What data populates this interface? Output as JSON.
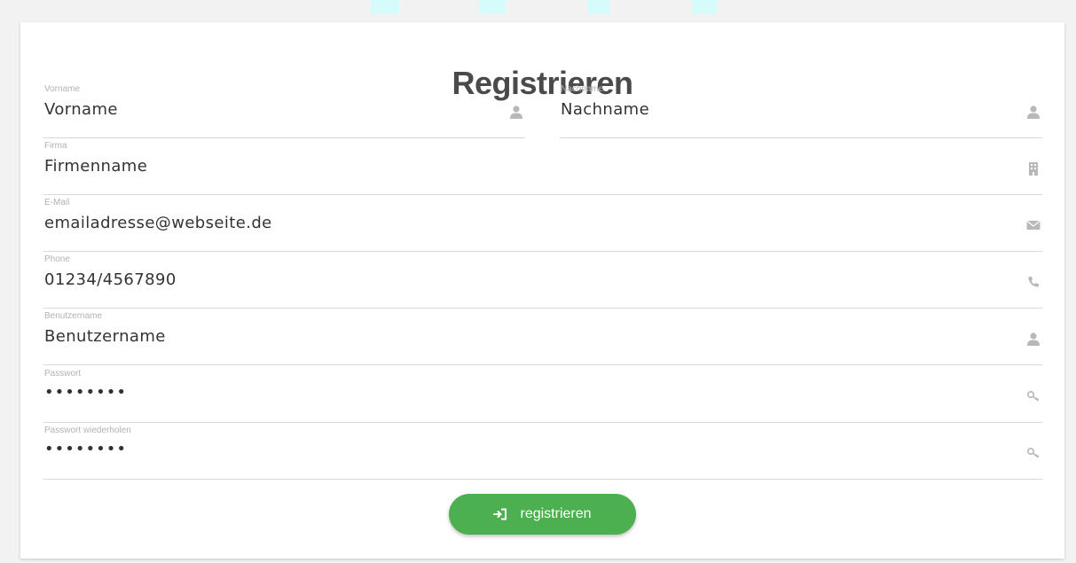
{
  "title": "Registrieren",
  "fields": {
    "vorname": {
      "label": "Vorname",
      "value": "Vorname",
      "icon": "user-icon"
    },
    "nachname": {
      "label": "Nachname",
      "value": "Nachname",
      "icon": "user-icon"
    },
    "firma": {
      "label": "Firma",
      "value": "Firmenname",
      "icon": "building-icon"
    },
    "email": {
      "label": "E-Mail",
      "value": "emailadresse@webseite.de",
      "icon": "envelope-icon"
    },
    "phone": {
      "label": "Phone",
      "value": "01234/4567890",
      "icon": "phone-icon"
    },
    "benutzername": {
      "label": "Benutzername",
      "value": "Benutzername",
      "icon": "user-icon"
    },
    "passwort": {
      "label": "Passwort",
      "value": "••••••••",
      "icon": "key-icon"
    },
    "passwort_wdh": {
      "label": "Passwort wiederholen",
      "value": "••••••••",
      "icon": "key-icon"
    }
  },
  "submit": {
    "label": "registrieren",
    "icon": "sign-in-icon"
  },
  "colors": {
    "button": "#4db050",
    "title": "#4a4a4a",
    "label": "#b2b2b2",
    "icon": "#b8b8b8",
    "underline": "#d9d9d9"
  }
}
